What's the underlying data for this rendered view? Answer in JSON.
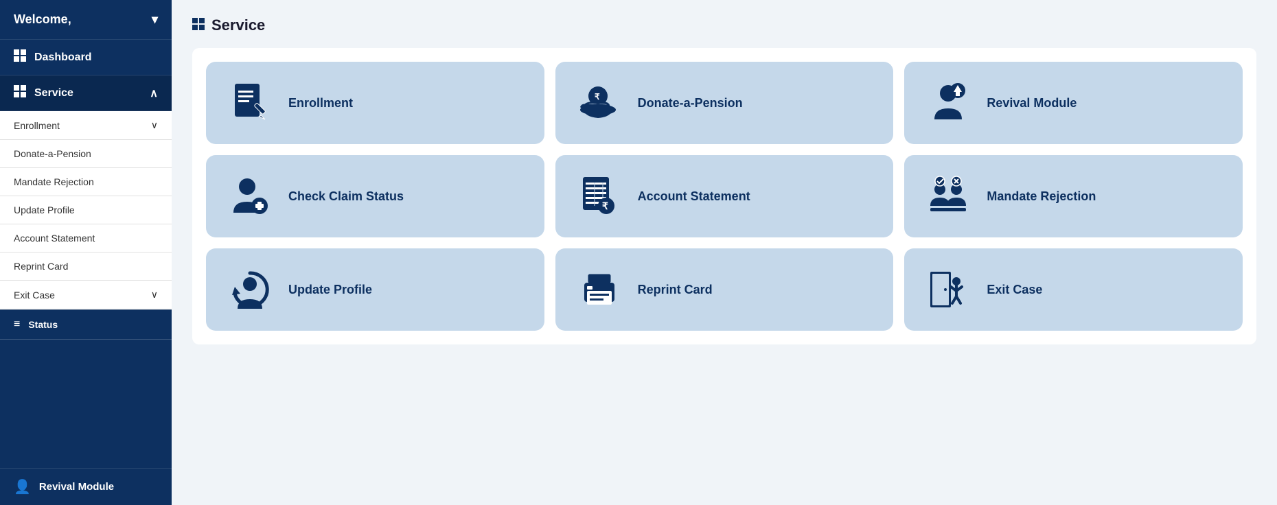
{
  "sidebar": {
    "welcome_label": "Welcome,",
    "welcome_chevron": "▾",
    "dashboard_label": "Dashboard",
    "service_label": "Service",
    "service_chevron": "∧",
    "sub_items": [
      {
        "label": "Enrollment",
        "has_chevron": true
      },
      {
        "label": "Donate-a-Pension",
        "has_chevron": false
      },
      {
        "label": "Mandate Rejection",
        "has_chevron": false
      },
      {
        "label": "Update Profile",
        "has_chevron": false
      },
      {
        "label": "Account Statement",
        "has_chevron": false
      },
      {
        "label": "Reprint Card",
        "has_chevron": false
      },
      {
        "label": "Exit Case",
        "has_chevron": true
      }
    ],
    "status_label": "Status",
    "revival_label": "Revival Module"
  },
  "main": {
    "page_title": "Service",
    "cards": [
      {
        "id": "enrollment",
        "label": "Enrollment"
      },
      {
        "id": "donate-a-pension",
        "label": "Donate-a-Pension"
      },
      {
        "id": "revival-module",
        "label": "Revival Module"
      },
      {
        "id": "check-claim-status",
        "label": "Check Claim Status"
      },
      {
        "id": "account-statement",
        "label": "Account Statement"
      },
      {
        "id": "mandate-rejection",
        "label": "Mandate Rejection"
      },
      {
        "id": "update-profile",
        "label": "Update Profile"
      },
      {
        "id": "reprint-card",
        "label": "Reprint Card"
      },
      {
        "id": "exit-case",
        "label": "Exit Case"
      }
    ]
  }
}
